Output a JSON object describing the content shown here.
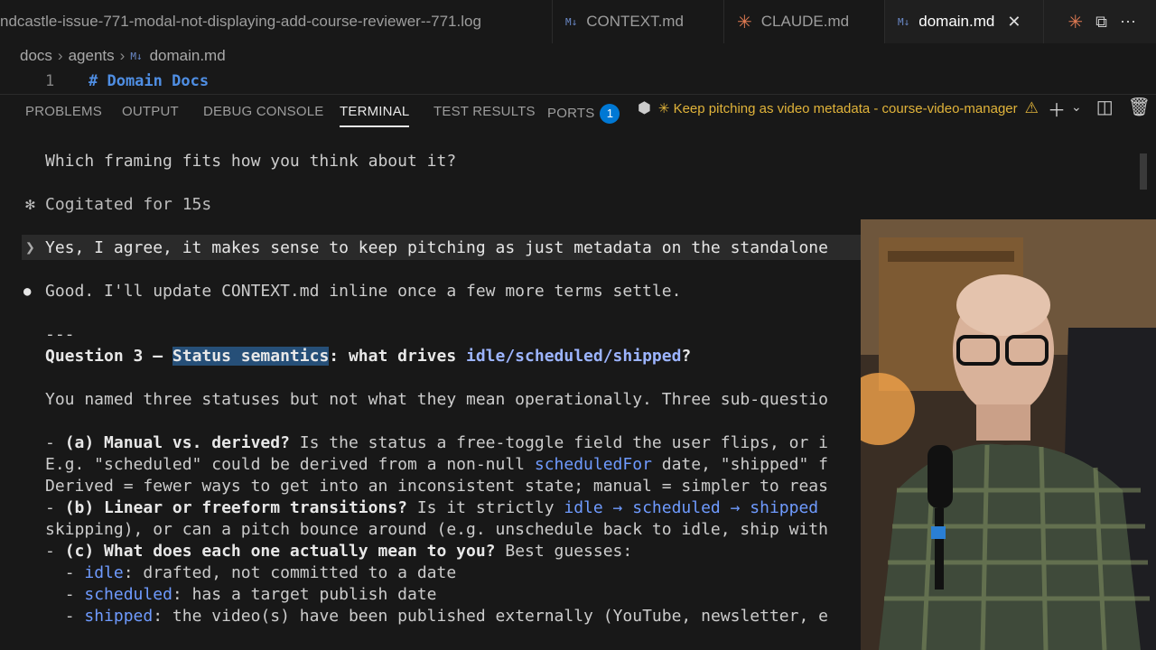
{
  "tabs": [
    {
      "label": "ndcastle-issue-771-modal-not-displaying-add-course-reviewer--771.log"
    },
    {
      "label": "CONTEXT.md",
      "icon": "markdown-icon"
    },
    {
      "label": "CLAUDE.md",
      "icon": "claude-icon"
    },
    {
      "label": "domain.md",
      "icon": "markdown-icon",
      "active": true
    }
  ],
  "breadcrumb": [
    "docs",
    "agents",
    "domain.md"
  ],
  "editor": {
    "line_number": "1",
    "line_text": "# Domain Docs"
  },
  "panel": {
    "tabs": [
      "PROBLEMS",
      "OUTPUT",
      "DEBUG CONSOLE",
      "TERMINAL",
      "TEST RESULTS",
      "PORTS"
    ],
    "active_tab": "TERMINAL",
    "ports_badge": "1",
    "session_title": "✳ Keep pitching as video metadata - course-video-manager"
  },
  "terminal": {
    "l1": "Which framing fits how you think about it?",
    "l2_prefix": "✻",
    "l2": "Cogitated for 15s",
    "l3_prefix": "❯",
    "l3": "Yes, I agree, it makes sense to keep pitching as just metadata on the standalone",
    "l4_prefix": "●",
    "l4": "Good. I'll update CONTEXT.md inline once a few more terms settle.",
    "l5": "---",
    "q3_a": "Question 3 — ",
    "q3_b": "Status semantics",
    "q3_c": ": what drives ",
    "q3_d": "idle/scheduled/shipped",
    "q3_e": "?",
    "l7": "You named three statuses but not what they mean operationally. Three sub-questio",
    "a_dash": "- ",
    "a_label": "(a) Manual vs. derived?",
    "a_text": " Is the status a free-toggle field the user flips, or i",
    "a2_1": "E.g. \"scheduled\" could be derived from a non-null ",
    "a2_2": "scheduledFor",
    "a2_3": " date, \"shipped\" f",
    "a3": "Derived = fewer ways to get into an inconsistent state; manual = simpler to reas",
    "b_label": "(b) Linear or freeform transitions?",
    "b_text": " Is it strictly ",
    "b_flow": "idle → scheduled → shipped",
    "b2": "skipping), or can a pitch bounce around (e.g. unschedule back to idle, ship with",
    "c_label": "(c) What does each one actually mean to you?",
    "c_text": " Best guesses:",
    "c1_k": "idle",
    "c1_v": ": drafted, not committed to a date",
    "c2_k": "scheduled",
    "c2_v": ": has a target publish date",
    "c3_k": "shipped",
    "c3_v": ": the video(s) have been published externally (YouTube, newsletter, e"
  },
  "colors": {
    "accent": "#0078d4",
    "session": "#e0b33a",
    "selection": "#264f78"
  }
}
